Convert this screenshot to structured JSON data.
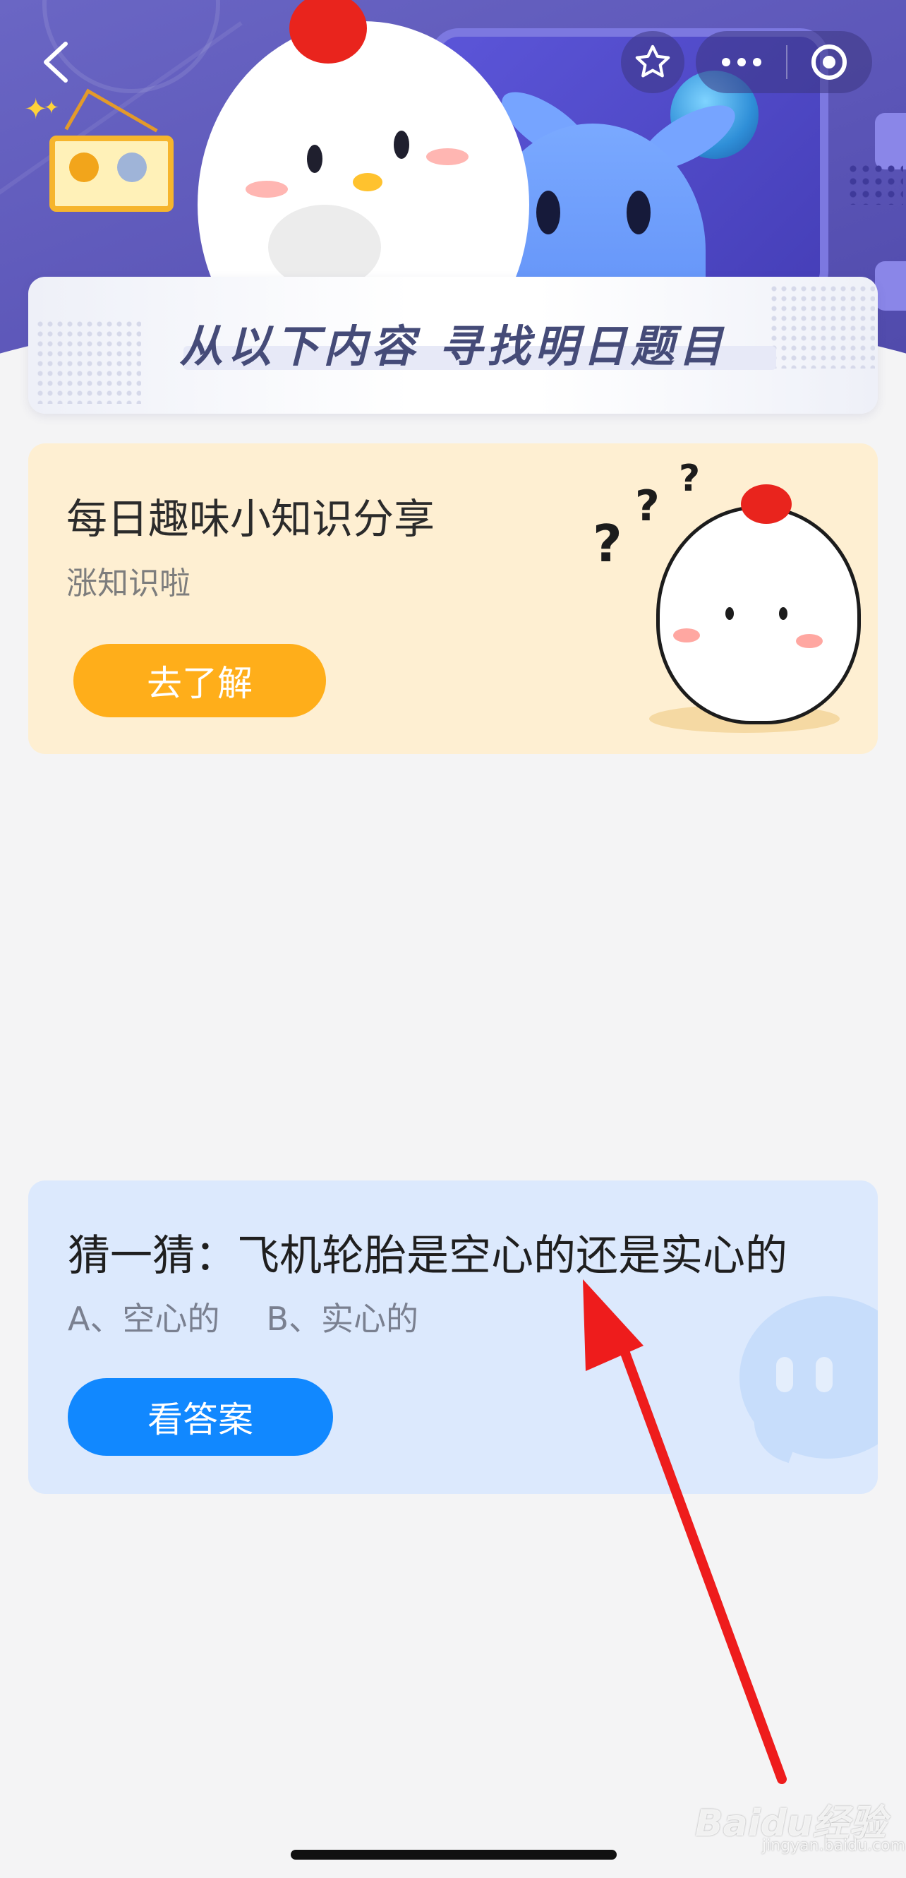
{
  "header": {
    "back_icon": "chevron-left-icon",
    "capsule_icons": [
      "star-icon",
      "more-dots-icon",
      "target-icon"
    ]
  },
  "banner": {
    "title": "从以下内容  寻找明日题目"
  },
  "knowledge_card": {
    "title": "每日趣味小知识分享",
    "subtitle": "涨知识啦",
    "button_label": "去了解",
    "accent": "#ffae1a",
    "background": "#feefd2"
  },
  "quiz_card": {
    "title": "猜一猜：飞机轮胎是空心的还是实心的",
    "option_a": "A、空心的",
    "option_b": "B、实心的",
    "button_label": "看答案",
    "accent": "#1188ff",
    "background": "#dce9fd"
  },
  "watermark": {
    "brand": "Baidu经验",
    "url": "jingyan.baidu.com"
  },
  "annotation": {
    "arrow_color": "#ee1c1c"
  }
}
